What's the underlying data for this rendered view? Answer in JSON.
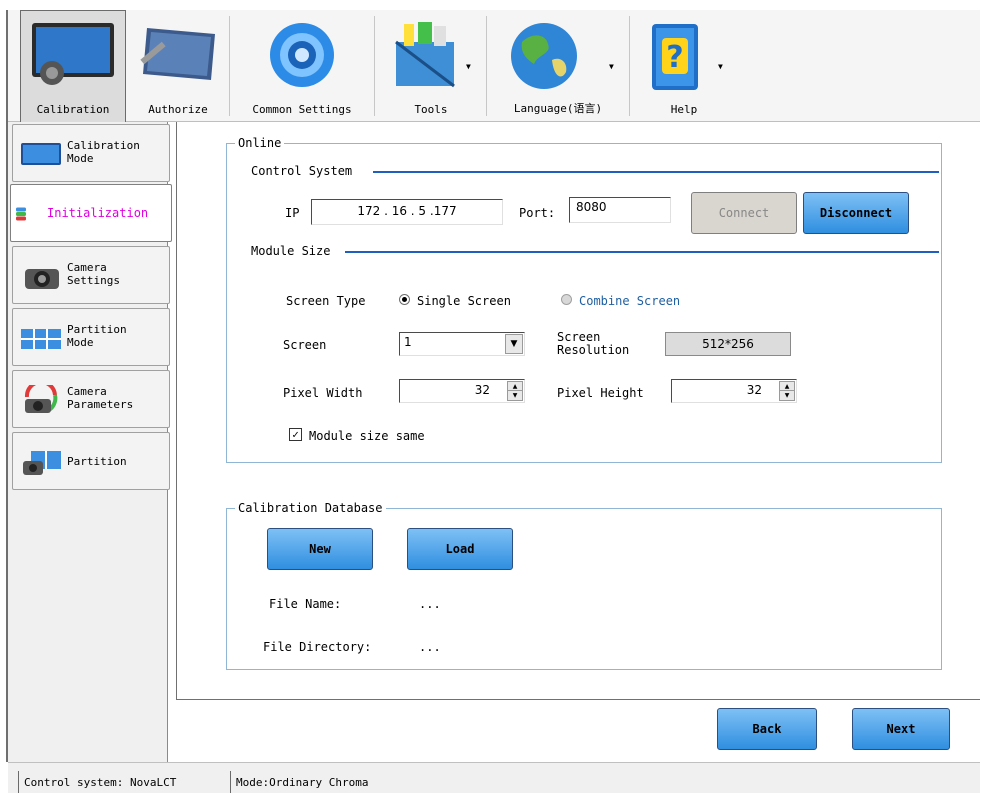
{
  "toolbar": {
    "items": [
      {
        "label": "Calibration",
        "icon": "monitor-camera-icon",
        "active": true
      },
      {
        "label": "Authorize",
        "icon": "panel-wrench-icon"
      },
      {
        "label": "Common Settings",
        "icon": "gear-icon"
      },
      {
        "label": "Tools",
        "icon": "toolbox-icon",
        "dropdown": true
      },
      {
        "label": "Language(语言)",
        "icon": "globe-icon",
        "dropdown": true
      },
      {
        "label": "Help",
        "icon": "help-book-icon",
        "dropdown": true
      }
    ]
  },
  "sidebar": {
    "items": [
      {
        "label_line1": "Calibration",
        "label_line2": "Mode",
        "icon": "monitor-icon"
      },
      {
        "label": "Initialization",
        "icon": "database-icon",
        "active": true
      },
      {
        "label_line1": "Camera",
        "label_line2": "Settings",
        "icon": "camera-icon"
      },
      {
        "label_line1": "Partition",
        "label_line2": "Mode",
        "icon": "grid-icon"
      },
      {
        "label_line1": "Camera",
        "label_line2": "Parameters",
        "icon": "camera-cycle-icon"
      },
      {
        "label": "Partition",
        "icon": "camera-partition-icon"
      }
    ]
  },
  "online": {
    "title": "Online",
    "control_system": {
      "title": "Control System",
      "ip_label": "IP",
      "ip_value": "172 . 16 . 5 .177",
      "port_label": "Port:",
      "port_value": "8080",
      "connect_label": "Connect",
      "disconnect_label": "Disconnect"
    },
    "module_size": {
      "title": "Module Size",
      "screen_type_label": "Screen Type",
      "single_screen": "Single Screen",
      "combine_screen": "Combine Screen",
      "screen_type_selected": "Single Screen",
      "screen_label": "Screen",
      "screen_value": "1",
      "resolution_label_1": "Screen",
      "resolution_label_2": "Resolution",
      "resolution_value": "512*256",
      "pixel_width_label": "Pixel Width",
      "pixel_width_value": "32",
      "pixel_height_label": "Pixel Height",
      "pixel_height_value": "32",
      "same_label": "Module size same",
      "same_checked": true
    }
  },
  "database": {
    "title": "Calibration Database",
    "new_label": "New",
    "load_label": "Load",
    "file_name_label": "File Name:",
    "file_name_value": "...",
    "file_dir_label": "File Directory:",
    "file_dir_value": "..."
  },
  "footer": {
    "back_label": "Back",
    "next_label": "Next"
  },
  "status": {
    "control_system": "Control system: NovaLCT",
    "mode": "Mode:Ordinary Chroma"
  },
  "colors": {
    "accent_blue": "#2f8fe0",
    "group_border": "#8fb6d4",
    "active_sidebar_text": "#e000e0",
    "combine_text": "#1f5fa0"
  }
}
